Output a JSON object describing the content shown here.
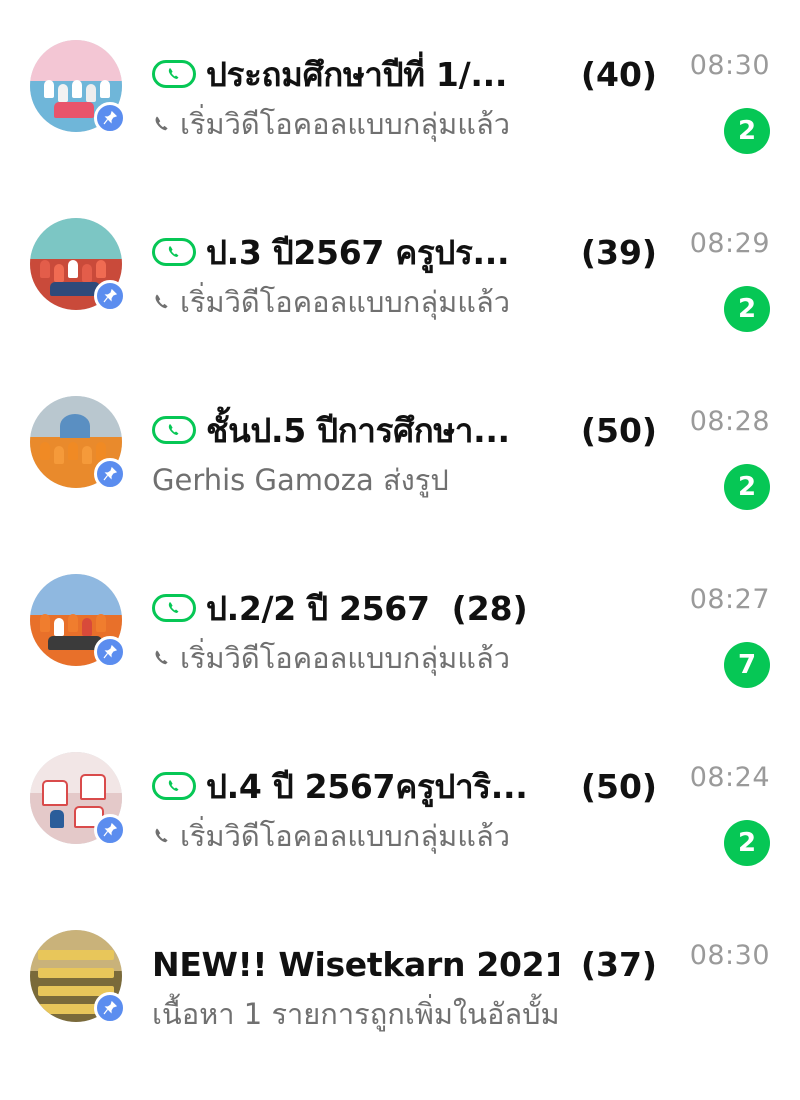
{
  "colors": {
    "accent_green": "#06c755",
    "pin_blue": "#5b8def",
    "time_gray": "#9a9a9a",
    "preview_gray": "#707070"
  },
  "chats": [
    {
      "title": "ประถมศึกษาปีที่ 1/...",
      "count": "(40)",
      "preview": "เริ่มวิดีโอคอลแบบกลุ่มแล้ว",
      "time": "08:30",
      "unread": "2",
      "group_call": true,
      "pinned": true
    },
    {
      "title": "ป.3 ปี2567   ครูปร...",
      "count": "(39)",
      "preview": "เริ่มวิดีโอคอลแบบกลุ่มแล้ว",
      "time": "08:29",
      "unread": "2",
      "group_call": true,
      "pinned": true
    },
    {
      "title": " ชั้นป.5 ปีการศึกษา...",
      "count": "(50)",
      "preview": "Gerhis Gamoza ส่งรูป",
      "time": "08:28",
      "unread": "2",
      "group_call": true,
      "pinned": true
    },
    {
      "title": "ป.2/2 ปี 2567",
      "count": "(28)",
      "preview": "เริ่มวิดีโอคอลแบบกลุ่มแล้ว",
      "time": "08:27",
      "unread": "7",
      "group_call": true,
      "pinned": true
    },
    {
      "title": "ป.4 ปี 2567ครูปาริ...",
      "count": "(50)",
      "preview": "เริ่มวิดีโอคอลแบบกลุ่มแล้ว",
      "time": "08:24",
      "unread": "2",
      "group_call": true,
      "pinned": true
    },
    {
      "title": "NEW!! Wisetkarn 2021",
      "count": "(37)",
      "preview": "เนื้อหา 1 รายการถูกเพิ่มในอัลบั้ม",
      "time": "08:30",
      "unread": "",
      "group_call": false,
      "pinned": true
    }
  ]
}
